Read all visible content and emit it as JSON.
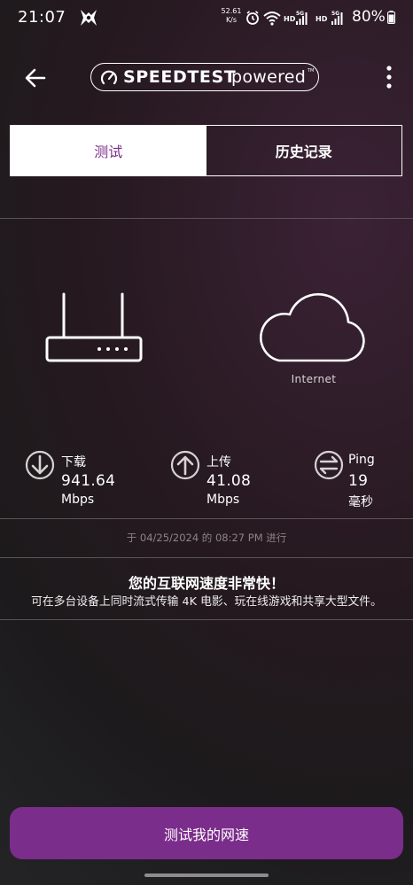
{
  "status_bar": {
    "time": "21:07",
    "net_speed_value": "52.61",
    "net_speed_unit": "K/s",
    "battery_percent": "80%",
    "icons": [
      "app-notification-icon",
      "alarm-icon",
      "wifi-icon",
      "hd-icon",
      "5g-signal-icon",
      "hd-icon",
      "5g-signal-icon",
      "battery-icon"
    ]
  },
  "app_bar": {
    "brand_strong": "SPEEDTEST",
    "brand_light": "powered",
    "brand_tm": "TM",
    "icons": [
      "back-arrow-icon",
      "speedtest-gauge-icon",
      "more-vertical-icon"
    ]
  },
  "tabs": [
    {
      "label": "测试",
      "active": true
    },
    {
      "label": "历史记录",
      "active": false
    }
  ],
  "devices": {
    "router_icon": "router-icon",
    "cloud_icon": "cloud-icon",
    "internet_label": "Internet"
  },
  "metrics": {
    "download": {
      "label": "下载",
      "value": "941.64",
      "unit": "Mbps",
      "icon": "download-arrow-icon"
    },
    "upload": {
      "label": "上传",
      "value": "41.08",
      "unit": "Mbps",
      "icon": "upload-arrow-icon"
    },
    "ping": {
      "label": "Ping",
      "value": "19",
      "unit": "毫秒",
      "icon": "ping-arrows-icon"
    }
  },
  "result": {
    "timestamp": "于 04/25/2024 的 08:27 PM 进行",
    "headline": "您的互联网速度非常快！",
    "description": "可在多台设备上同时流式传输 4K 电影、玩在线游戏和共享大型文件。"
  },
  "actions": {
    "start_button_label": "测试我的网速"
  },
  "colors": {
    "accent": "#7b2d8b",
    "background_dark": "#1c1a1c",
    "text_primary": "#ffffff",
    "text_muted": "#8a8488"
  }
}
